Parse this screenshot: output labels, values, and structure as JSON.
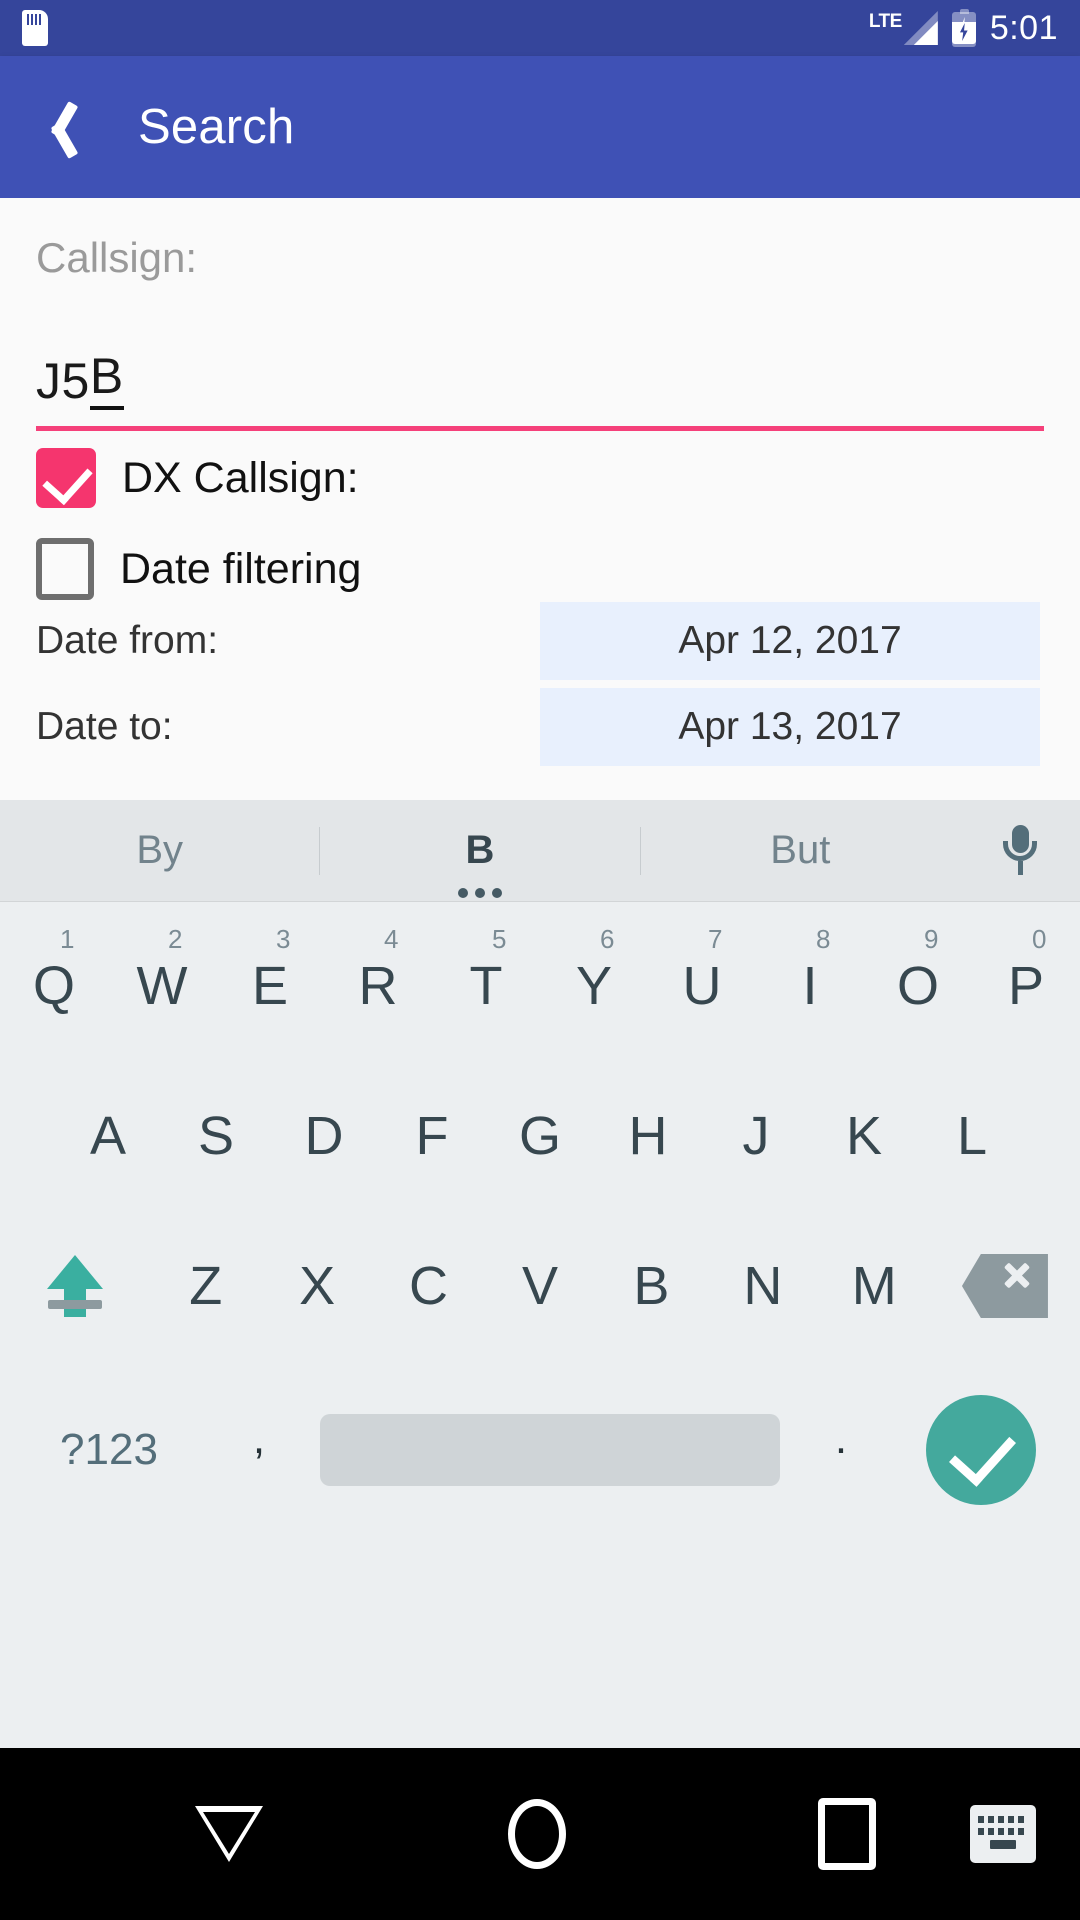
{
  "statusbar": {
    "sd_icon": "sd-card-icon",
    "network_label": "LTE",
    "signal_icon": "signal-bars-icon",
    "battery_icon": "battery-charging-icon",
    "time": "5:01"
  },
  "appbar": {
    "back_icon": "back-chevron-icon",
    "title": "Search",
    "background": "#3f51b5"
  },
  "form": {
    "callsign_label": "Callsign:",
    "callsign_value": "J5",
    "callsign_composing": "B",
    "underline_color": "#f5407a",
    "dx_callsign": {
      "label": "DX Callsign:",
      "checked": "true",
      "color": "#f5356e"
    },
    "date_filtering": {
      "label": "Date filtering",
      "checked": "false"
    },
    "date_from": {
      "label": "Date from:",
      "value": "Apr 12, 2017"
    },
    "date_to": {
      "label": "Date to:",
      "value": "Apr 13, 2017"
    }
  },
  "keyboard": {
    "suggestions": [
      {
        "text": "By",
        "active": "false"
      },
      {
        "text": "B",
        "active": "true"
      },
      {
        "text": "But",
        "active": "false"
      }
    ],
    "mic_icon": "microphone-icon",
    "row1": [
      {
        "letter": "Q",
        "num": "1"
      },
      {
        "letter": "W",
        "num": "2"
      },
      {
        "letter": "E",
        "num": "3"
      },
      {
        "letter": "R",
        "num": "4"
      },
      {
        "letter": "T",
        "num": "5"
      },
      {
        "letter": "Y",
        "num": "6"
      },
      {
        "letter": "U",
        "num": "7"
      },
      {
        "letter": "I",
        "num": "8"
      },
      {
        "letter": "O",
        "num": "9"
      },
      {
        "letter": "P",
        "num": "0"
      }
    ],
    "row2": [
      "A",
      "S",
      "D",
      "F",
      "G",
      "H",
      "J",
      "K",
      "L"
    ],
    "row3": [
      "Z",
      "X",
      "C",
      "V",
      "B",
      "N",
      "M"
    ],
    "shift_icon": "shift-caps-icon",
    "backspace_icon": "backspace-icon",
    "symbols_label": "?123",
    "comma": ",",
    "space_label": "",
    "period": ".",
    "enter_icon": "check-enter-icon",
    "accent_color": "#44a99d"
  },
  "navbar": {
    "back_icon": "hide-keyboard-down-icon",
    "home_icon": "home-circle-icon",
    "recents_icon": "recents-square-icon",
    "switch_keyboard_icon": "switch-keyboard-icon"
  }
}
